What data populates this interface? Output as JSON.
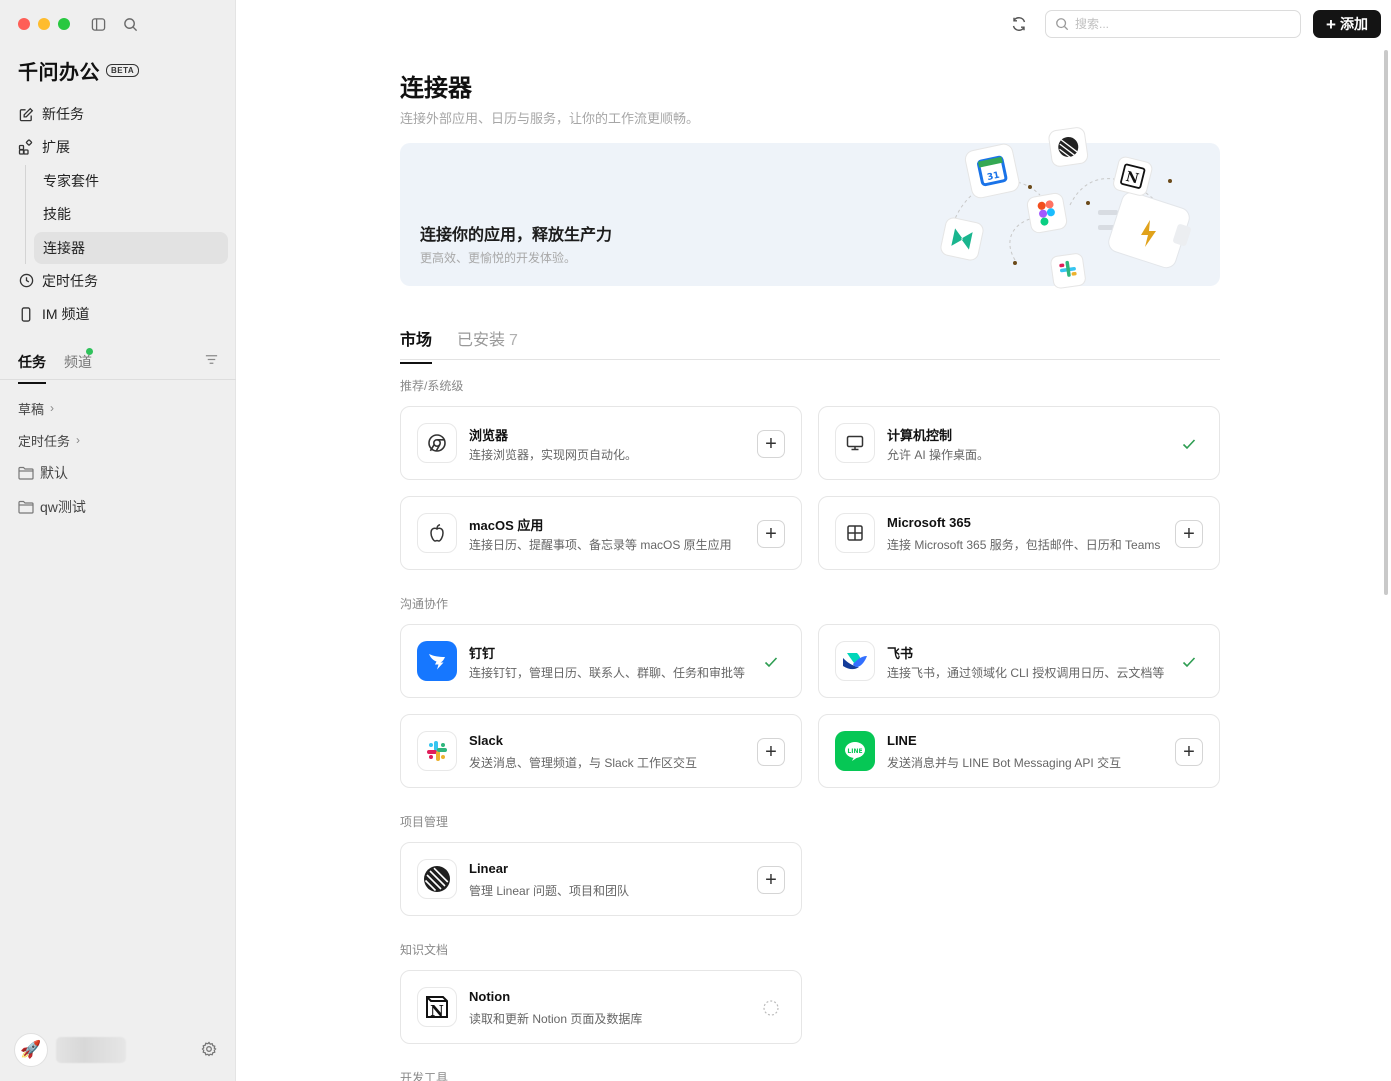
{
  "sidebar": {
    "brand": "千问办公",
    "badge": "BETA",
    "nav": {
      "new_task": "新任务",
      "extensions": "扩展",
      "expert_suite": "专家套件",
      "skills": "技能",
      "connectors": "连接器",
      "scheduled": "定时任务",
      "im_channel": "IM 频道"
    },
    "tabs": {
      "tasks": "任务",
      "channels": "频道"
    },
    "list": {
      "drafts": "草稿",
      "scheduled": "定时任务",
      "folder_default": "默认",
      "folder_qw": "qw测试"
    },
    "user": {
      "avatar": "🚀"
    }
  },
  "topbar": {
    "search_placeholder": "搜索...",
    "add_label": "添加"
  },
  "page": {
    "title": "连接器",
    "subtitle": "连接外部应用、日历与服务，让你的工作流更顺畅。"
  },
  "banner": {
    "title": "连接你的应用，释放生产力",
    "subtitle": "更高效、更愉悦的开发体验。"
  },
  "tabs": {
    "market": "市场",
    "installed": "已安装",
    "installed_count": "7"
  },
  "sections": {
    "recommended": "推荐/系统级",
    "communication": "沟通协作",
    "project": "项目管理",
    "knowledge": "知识文档",
    "dev": "开发工具"
  },
  "connectors": {
    "browser": {
      "name": "浏览器",
      "desc": "连接浏览器，实现网页自动化。",
      "status": "add",
      "icon": "chrome-icon"
    },
    "computer": {
      "name": "计算机控制",
      "desc": "允许 AI 操作桌面。",
      "status": "installed",
      "icon": "monitor-icon"
    },
    "macos": {
      "name": "macOS 应用",
      "desc": "连接日历、提醒事项、备忘录等 macOS 原生应用",
      "status": "add",
      "icon": "apple-icon"
    },
    "m365": {
      "name": "Microsoft 365",
      "desc": "连接 Microsoft 365 服务，包括邮件、日历和 Teams",
      "status": "add",
      "icon": "windows-grid-icon"
    },
    "dingtalk": {
      "name": "钉钉",
      "desc": "连接钉钉，管理日历、联系人、群聊、任务和审批等",
      "status": "installed",
      "icon": "dingtalk-icon",
      "color": "#1677ff"
    },
    "feishu": {
      "name": "飞书",
      "desc": "连接飞书，通过领域化 CLI 授权调用日历、云文档等",
      "status": "installed",
      "icon": "feishu-icon"
    },
    "slack": {
      "name": "Slack",
      "desc": "发送消息、管理频道，与 Slack 工作区交互",
      "status": "add",
      "icon": "slack-icon"
    },
    "line": {
      "name": "LINE",
      "desc": "发送消息并与 LINE Bot Messaging API 交互",
      "status": "add",
      "icon": "line-icon",
      "color": "#06c755"
    },
    "linear": {
      "name": "Linear",
      "desc": "管理 Linear 问题、项目和团队",
      "status": "add",
      "icon": "linear-icon"
    },
    "notion": {
      "name": "Notion",
      "desc": "读取和更新 Notion 页面及数据库",
      "status": "loading",
      "icon": "notion-icon"
    }
  },
  "colors": {
    "accent_green": "#2e9d52",
    "dark": "#141414",
    "banner_bg": "#eef3f9"
  }
}
